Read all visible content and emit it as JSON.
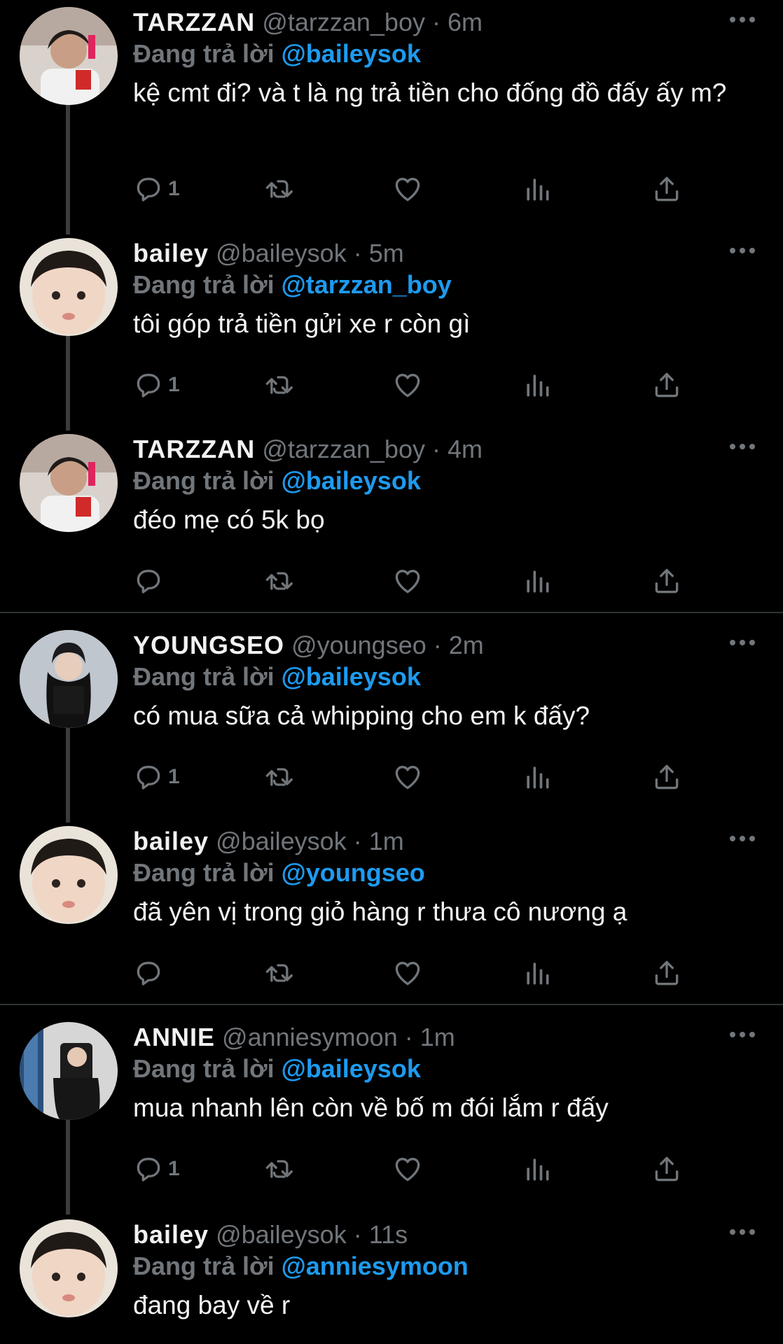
{
  "reply_prefix": "Đang trả lời",
  "tweets": [
    {
      "name": "TARZZAN",
      "handle": "@tarzzan_boy",
      "time": "6m",
      "mention": "@baileysok",
      "text": "kệ cmt đi? và t là ng trả tiền cho đống đồ đấy ấy m?",
      "reply_count": "1",
      "avatar": "tarzzan-avatar"
    },
    {
      "name": "bailey",
      "handle": "@baileysok",
      "time": "5m",
      "mention": "@tarzzan_boy",
      "text": "tôi góp trả tiền gửi xe r còn gì",
      "reply_count": "1",
      "avatar": "bailey-avatar"
    },
    {
      "name": "TARZZAN",
      "handle": "@tarzzan_boy",
      "time": "4m",
      "mention": "@baileysok",
      "text": "đéo mẹ có 5k bọ",
      "reply_count": "",
      "avatar": "tarzzan-avatar"
    },
    {
      "name": "YOUNGSEO",
      "handle": "@youngseo",
      "time": "2m",
      "mention": "@baileysok",
      "text": "có mua sữa cả whipping cho em k đấy?",
      "reply_count": "1",
      "avatar": "youngseo-avatar"
    },
    {
      "name": "bailey",
      "handle": "@baileysok",
      "time": "1m",
      "mention": "@youngseo",
      "text": "đã yên vị trong giỏ hàng r thưa cô nương ạ",
      "reply_count": "",
      "avatar": "bailey-avatar"
    },
    {
      "name": "ANNIE",
      "handle": "@anniesymoon",
      "time": "1m",
      "mention": "@baileysok",
      "text": "mua nhanh lên còn về bố m đói lắm r đấy",
      "reply_count": "1",
      "avatar": "annie-avatar"
    },
    {
      "name": "bailey",
      "handle": "@baileysok",
      "time": "11s",
      "mention": "@anniesymoon",
      "text": "đang bay về r",
      "reply_count": "",
      "avatar": "bailey-avatar"
    }
  ],
  "colors": {
    "background": "#000000",
    "text": "#e7e9ea",
    "muted": "#71767b",
    "mention": "#1d9bf0",
    "divider": "#2f3336"
  }
}
